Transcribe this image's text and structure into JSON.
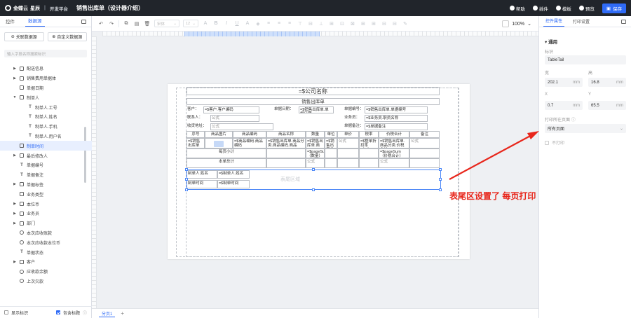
{
  "topbar": {
    "logo": "金蝶云",
    "brand": "星辰",
    "platform": "开发平台",
    "title": "销售出库单（设计器介绍）",
    "help": "帮助",
    "plugin": "插件",
    "template": "模板",
    "preview": "预览",
    "save": "保存"
  },
  "left": {
    "tab_controls": "控件",
    "tab_datasource": "数据源",
    "btn_relate": "关联数据源",
    "btn_custom": "自定义数据源",
    "search_placeholder": "输入字段名称搜索标识",
    "tree": [
      {
        "label": "配送信息",
        "arrow": "▶",
        "icon": "box"
      },
      {
        "label": "销售费用单据体",
        "arrow": "▶",
        "icon": "box"
      },
      {
        "label": "单据日期",
        "arrow": "",
        "icon": "box"
      },
      {
        "label": "制单人",
        "arrow": "▼",
        "icon": "person"
      },
      {
        "label": "制单人.工号",
        "arrow": "",
        "icon": "text",
        "indent": true
      },
      {
        "label": "制单人.姓名",
        "arrow": "",
        "icon": "text",
        "indent": true
      },
      {
        "label": "制单人.手机",
        "arrow": "",
        "icon": "text",
        "indent": true
      },
      {
        "label": "制单人.用户名",
        "arrow": "",
        "icon": "text",
        "indent": true
      },
      {
        "label": "制单时间",
        "arrow": "",
        "icon": "box",
        "active": true
      },
      {
        "label": "最后修改人",
        "arrow": "▶",
        "icon": "person"
      },
      {
        "label": "单据编号",
        "arrow": "",
        "icon": "text"
      },
      {
        "label": "单据备注",
        "arrow": "",
        "icon": "text"
      },
      {
        "label": "单据标签",
        "arrow": "▶",
        "icon": "box"
      },
      {
        "label": "业务类型",
        "arrow": "",
        "icon": "box"
      },
      {
        "label": "本位币",
        "arrow": "▶",
        "icon": "box"
      },
      {
        "label": "业务员",
        "arrow": "▶",
        "icon": "box"
      },
      {
        "label": "部门",
        "arrow": "▶",
        "icon": "box"
      },
      {
        "label": "本次应收账款",
        "arrow": "",
        "icon": "circle"
      },
      {
        "label": "本次应收款本位币",
        "arrow": "",
        "icon": "circle"
      },
      {
        "label": "单据状态",
        "arrow": "",
        "icon": "text"
      },
      {
        "label": "客户",
        "arrow": "▶",
        "icon": "box"
      },
      {
        "label": "应收款余额",
        "arrow": "",
        "icon": "circle"
      },
      {
        "label": "上次欠款",
        "arrow": "",
        "icon": "circle"
      }
    ],
    "show_id": "显示标识",
    "include_title": "包含标题"
  },
  "toolbar": {
    "font": "宋体",
    "size": "12",
    "zoom": "100%"
  },
  "ruler": {
    "marks": "|  ·  ·  ·  ·  ·  |"
  },
  "report": {
    "company": "=$公司名称",
    "title": "销售出库单",
    "customer_lbl": "客户：",
    "customer_val": "=$客户.客户编码",
    "date_lbl": "单据日期：",
    "date_val": "=$销售出库单.单据日期",
    "no_lbl": "单据编号：",
    "no_val": "=$销售出库单.单据编号",
    "contact_lbl": "联系人：",
    "contact_val": "公式",
    "salesman_lbl": "业务员：",
    "salesman_val": "=$业务员.职员名称",
    "addr_lbl": "收货地址：",
    "addr_val": "公式",
    "remark_lbl": "单据备注：",
    "remark_val": "=$单据备注",
    "cols": [
      "序号",
      "商品图片",
      "商品编码",
      "商品名称",
      "数量",
      "单位",
      "单价",
      "税率",
      "价税合计",
      "备注"
    ],
    "row": [
      "=$销售出库单",
      "",
      "=$商品编码.商品编码",
      "=$销售出库单.商品分类.商品编码.商品",
      "=$销售出库单.商",
      "=$销售出库单",
      "公式",
      "=$整单折扣率（%）",
      "=$销售出库单.商品分类.价税合计",
      "公式"
    ],
    "page_sum": "每页小计",
    "page_qty": "=$pageSum（数量）",
    "page_total": "=$pageSum（价税合计）",
    "total": "本单总计",
    "formula": "公式",
    "tail_maker_lbl": "制单人.姓名",
    "tail_maker_val": "=$制单人.姓名",
    "tail_time_lbl": "制单时间",
    "tail_time_val": "=$制单时间",
    "band": "表尾区域"
  },
  "sheet_tab": "分页1",
  "right": {
    "tab_props": "控件属性",
    "tab_print": "打印设置",
    "section": "通用",
    "id_lbl": "标识",
    "id_val": "TableTail",
    "w_lbl": "宽",
    "w_val": "202.1",
    "h_lbl": "高",
    "h_val": "16.8",
    "x_lbl": "X",
    "x_val": "0.7",
    "y_lbl": "Y",
    "y_val": "65.5",
    "unit": "mm",
    "page_lbl": "打印所在页面",
    "page_val": "所有页面",
    "noprint": "不打印"
  },
  "annotation": "表尾区设置了 每页打印",
  "colors": {
    "accent": "#2f6bf6",
    "annotation": "#e8261b",
    "topbar": "#21252b"
  }
}
